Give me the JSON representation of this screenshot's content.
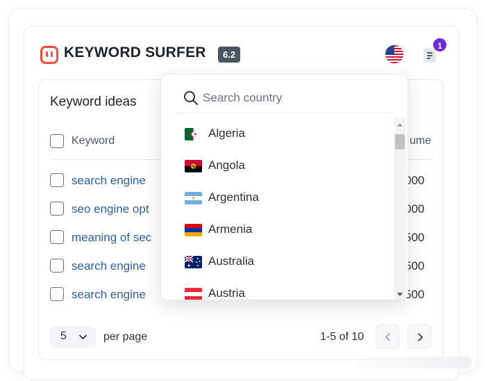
{
  "brand": {
    "title": "KEYWORD SURFER",
    "version": "6.2",
    "accent_color": "#ef4d3c",
    "logo_icon": "surfer-logo-icon"
  },
  "header": {
    "country_flag_icon": "us-flag-icon",
    "doc_icon": "clipboard-icon",
    "notification_count": "1",
    "notification_color": "#6d28d9"
  },
  "panel": {
    "title": "Keyword ideas",
    "columns": {
      "keyword": "Keyword",
      "volume": "ume"
    },
    "rows": [
      {
        "keyword": "search engine",
        "volume": "000"
      },
      {
        "keyword": "seo engine opt",
        "volume": "000"
      },
      {
        "keyword": "meaning of sec",
        "volume": "500"
      },
      {
        "keyword": "search engine",
        "volume": "500"
      },
      {
        "keyword": "search engine",
        "volume": "500"
      }
    ],
    "link_color": "#2f5fa5"
  },
  "pagination": {
    "per_page_value": "5",
    "per_page_label": "per page",
    "range_text": "1-5 of 10",
    "prev_icon": "chevron-left-icon",
    "next_icon": "chevron-right-icon"
  },
  "country_dropdown": {
    "search_placeholder": "Search country",
    "search_icon": "search-icon",
    "countries": [
      {
        "name": "Algeria",
        "flag": "algeria-flag-icon"
      },
      {
        "name": "Angola",
        "flag": "angola-flag-icon"
      },
      {
        "name": "Argentina",
        "flag": "argentina-flag-icon"
      },
      {
        "name": "Armenia",
        "flag": "armenia-flag-icon"
      },
      {
        "name": "Australia",
        "flag": "australia-flag-icon"
      },
      {
        "name": "Austria",
        "flag": "austria-flag-icon"
      }
    ]
  }
}
